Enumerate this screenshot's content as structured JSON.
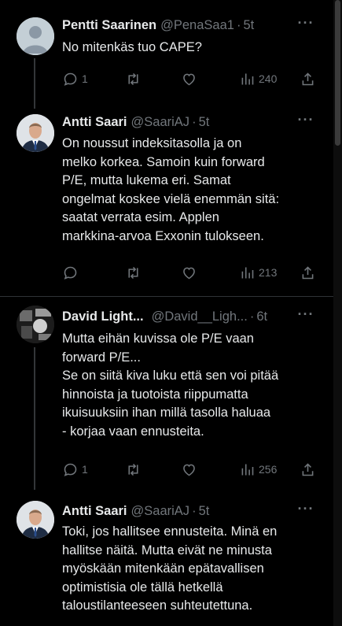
{
  "tweets": [
    {
      "name": "Pentti Saarinen",
      "handle": "@PenaSaa1",
      "dot": "·",
      "time": "5t",
      "more": "···",
      "lines": [
        "No mitenkäs tuo CAPE?"
      ],
      "replies": "1",
      "views": "240"
    },
    {
      "name": "Antti Saari",
      "handle": "@SaariAJ",
      "dot": "·",
      "time": "5t",
      "more": "···",
      "lines": [
        "On noussut indeksitasolla ja on",
        "melko korkea. Samoin kuin forward",
        "P/E, mutta lukema eri. Samat",
        "ongelmat koskee vielä enemmän sitä:",
        "saatat verrata esim. Applen",
        "markkina-arvoa Exxonin tulokseen."
      ],
      "replies": "",
      "views": "213"
    },
    {
      "name": "David Light...",
      "handle": "@David__Ligh...",
      "dot": "·",
      "time": "6t",
      "more": "···",
      "lines": [
        "Mutta eihän kuvissa ole P/E vaan",
        "forward P/E...",
        "Se on siitä kiva luku että sen voi pitää",
        "hinnoista ja tuotoista riippumatta",
        "ikuisuuksiin ihan millä tasolla haluaa",
        "- korjaa vaan ennusteita."
      ],
      "replies": "1",
      "views": "256"
    },
    {
      "name": "Antti Saari",
      "handle": "@SaariAJ",
      "dot": "·",
      "time": "5t",
      "more": "···",
      "lines": [
        "Toki, jos hallitsee ennusteita. Minä en",
        "hallitse näitä. Mutta eivät ne minusta",
        "myöskään mitenkään epätavallisen",
        "optimistisia ole tällä hetkellä",
        "taloustilanteeseen suhteutettuna."
      ],
      "replies": "",
      "views": ""
    }
  ],
  "icons": {
    "reply": "reply-icon",
    "retweet": "retweet-icon",
    "like": "heart-icon",
    "views": "views-icon",
    "share": "share-icon"
  },
  "colors": {
    "background": "#000000",
    "text": "#e7e9ea",
    "muted": "#71767b",
    "border": "#2f3336"
  }
}
